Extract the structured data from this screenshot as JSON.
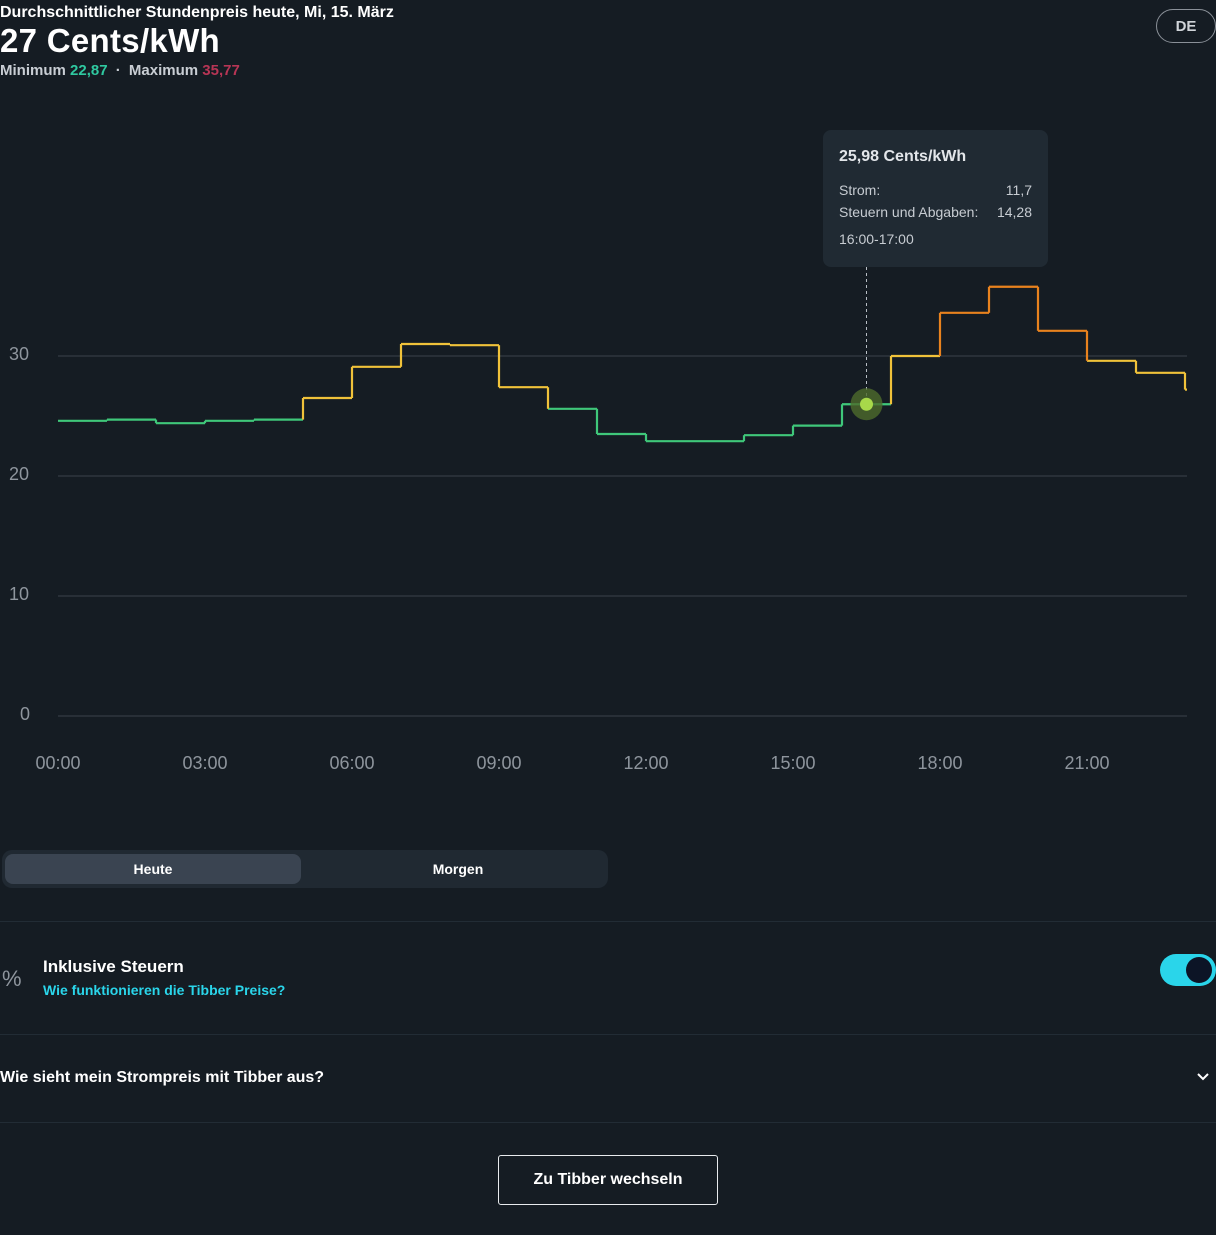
{
  "header": {
    "subtitle": "Durchschnittlicher Stundenpreis heute, Mi, 15. März",
    "price": "27 Cents/kWh",
    "min_label": "Minimum",
    "min_value": "22,87",
    "separator": "·",
    "max_label": "Maximum",
    "max_value": "35,77",
    "min_color": "#2fc8a0",
    "max_color": "#b73555"
  },
  "lang_button": "DE",
  "tooltip": {
    "title": "25,98 Cents/kWh",
    "rows": [
      {
        "label": "Strom:",
        "value": "11,7"
      },
      {
        "label": "Steuern und Abgaben:",
        "value": "14,28"
      }
    ],
    "time": "16:00-17:00"
  },
  "chart_data": {
    "type": "line",
    "step": true,
    "x": [
      "00:00",
      "01:00",
      "02:00",
      "03:00",
      "04:00",
      "05:00",
      "06:00",
      "07:00",
      "08:00",
      "09:00",
      "10:00",
      "11:00",
      "12:00",
      "13:00",
      "14:00",
      "15:00",
      "16:00",
      "17:00",
      "18:00",
      "19:00",
      "20:00",
      "21:00",
      "22:00",
      "23:00"
    ],
    "series": [
      {
        "values": [
          24.6,
          24.7,
          24.4,
          24.6,
          24.7,
          26.5,
          29.1,
          31.0,
          30.9,
          27.4,
          25.6,
          23.5,
          22.9,
          22.9,
          23.4,
          24.2,
          25.98,
          30.0,
          33.6,
          35.77,
          32.1,
          29.6,
          28.6,
          27.2
        ]
      }
    ],
    "highlight": {
      "x": "16:00",
      "value": 25.98
    },
    "xticks": [
      "00:00",
      "03:00",
      "06:00",
      "09:00",
      "12:00",
      "15:00",
      "18:00",
      "21:00"
    ],
    "yticks": [
      0,
      10,
      20,
      30
    ],
    "ylim": [
      0,
      36
    ],
    "grid": true,
    "colors": {
      "low": "#3fc77a",
      "mid": "#f0c23a",
      "high": "#e8821e",
      "grid": "#3a424b",
      "highlight": "#a8d84a"
    }
  },
  "tabs": [
    {
      "label": "Heute",
      "active": true
    },
    {
      "label": "Morgen",
      "active": false
    }
  ],
  "tax": {
    "icon": "percent-icon",
    "title": "Inklusive Steuern",
    "link": "Wie funktionieren die Tibber Preise?",
    "toggle_on": true
  },
  "faq": {
    "title": "Wie sieht mein Strompreis mit Tibber aus?",
    "icon": "chevron-down-icon"
  },
  "cta": "Zu Tibber wechseln"
}
